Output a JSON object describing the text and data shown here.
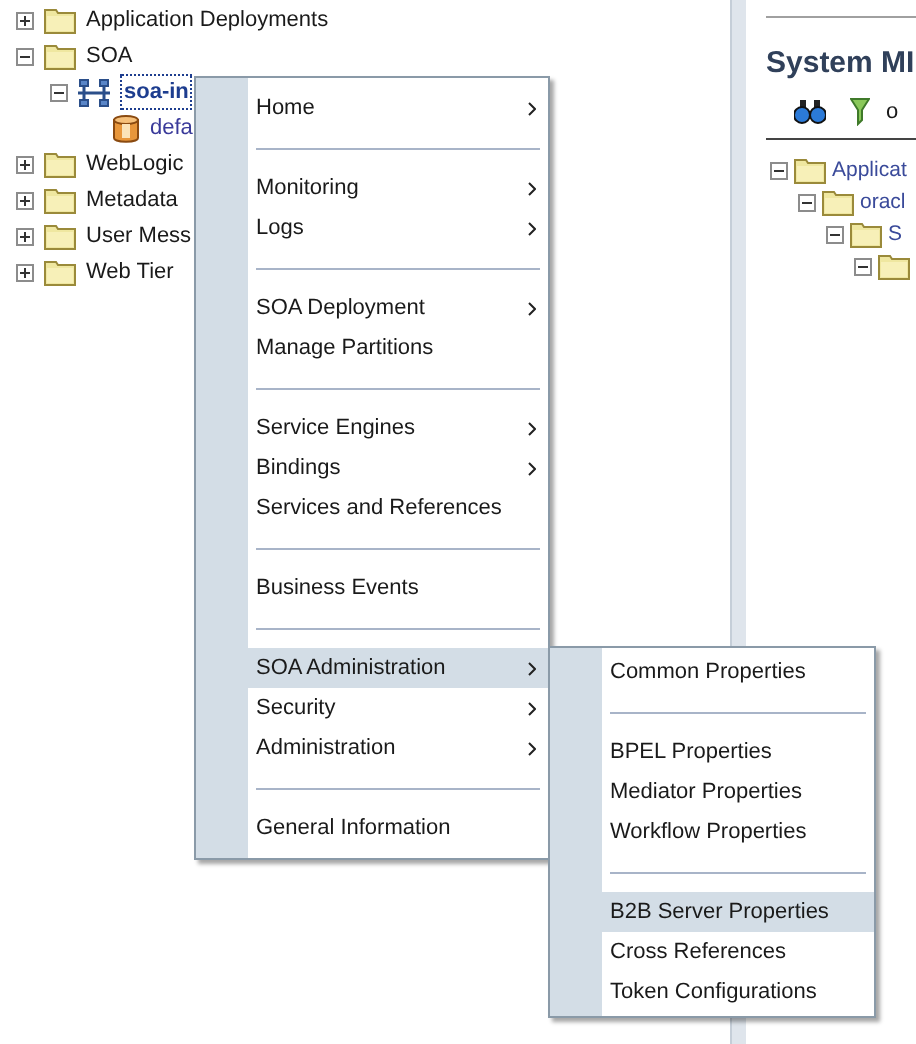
{
  "navigator": {
    "tree": [
      {
        "label": "Application Deployments",
        "kind": "folder",
        "expanded": false
      },
      {
        "label": "SOA",
        "kind": "folder",
        "expanded": true,
        "children": [
          {
            "label": "soa-in",
            "kind": "soa-infra",
            "expanded": true,
            "selected": true,
            "children": [
              {
                "label": "defa",
                "kind": "partition",
                "selected": false
              }
            ]
          }
        ]
      },
      {
        "label": "WebLogic",
        "kind": "folder",
        "expanded": false
      },
      {
        "label": "Metadata",
        "kind": "folder",
        "expanded": false
      },
      {
        "label": "User Mess",
        "kind": "folder",
        "expanded": false
      },
      {
        "label": "Web Tier",
        "kind": "folder",
        "expanded": false
      }
    ]
  },
  "context_menu": {
    "items": [
      {
        "kind": "item",
        "label": "Home",
        "submenu": true,
        "selected": false
      },
      {
        "kind": "separator"
      },
      {
        "kind": "item",
        "label": "Monitoring",
        "submenu": true,
        "selected": false
      },
      {
        "kind": "item",
        "label": "Logs",
        "submenu": true,
        "selected": false
      },
      {
        "kind": "separator"
      },
      {
        "kind": "item",
        "label": "SOA Deployment",
        "submenu": true,
        "selected": false
      },
      {
        "kind": "item",
        "label": "Manage Partitions",
        "submenu": false,
        "selected": false
      },
      {
        "kind": "separator"
      },
      {
        "kind": "item",
        "label": "Service Engines",
        "submenu": true,
        "selected": false
      },
      {
        "kind": "item",
        "label": "Bindings",
        "submenu": true,
        "selected": false
      },
      {
        "kind": "item",
        "label": "Services and References",
        "submenu": false,
        "selected": false
      },
      {
        "kind": "separator"
      },
      {
        "kind": "item",
        "label": "Business Events",
        "submenu": false,
        "selected": false
      },
      {
        "kind": "separator"
      },
      {
        "kind": "item",
        "label": "SOA Administration",
        "submenu": true,
        "selected": true
      },
      {
        "kind": "item",
        "label": "Security",
        "submenu": true,
        "selected": false
      },
      {
        "kind": "item",
        "label": "Administration",
        "submenu": true,
        "selected": false
      },
      {
        "kind": "separator"
      },
      {
        "kind": "item",
        "label": "General Information",
        "submenu": false,
        "selected": false
      }
    ]
  },
  "submenu": {
    "items": [
      {
        "kind": "item",
        "label": "Common Properties",
        "selected": false
      },
      {
        "kind": "separator"
      },
      {
        "kind": "item",
        "label": "BPEL Properties",
        "selected": false
      },
      {
        "kind": "item",
        "label": "Mediator Properties",
        "selected": false
      },
      {
        "kind": "item",
        "label": "Workflow Properties",
        "selected": false
      },
      {
        "kind": "separator"
      },
      {
        "kind": "item",
        "label": "B2B Server Properties",
        "selected": true
      },
      {
        "kind": "item",
        "label": "Cross References",
        "selected": false
      },
      {
        "kind": "item",
        "label": "Token Configurations",
        "selected": false
      }
    ]
  },
  "content": {
    "title": "System MI",
    "toolbar": [
      {
        "kind": "binoculars"
      },
      {
        "kind": "filter"
      },
      {
        "kind": "text",
        "label": "o"
      }
    ],
    "tree": [
      {
        "label": "Applicat",
        "expanded": true,
        "children": [
          {
            "label": "oracl",
            "expanded": true,
            "children": [
              {
                "label": "S",
                "expanded": true,
                "children": [
                  {
                    "expanded": true
                  }
                ]
              }
            ]
          }
        ]
      }
    ]
  }
}
